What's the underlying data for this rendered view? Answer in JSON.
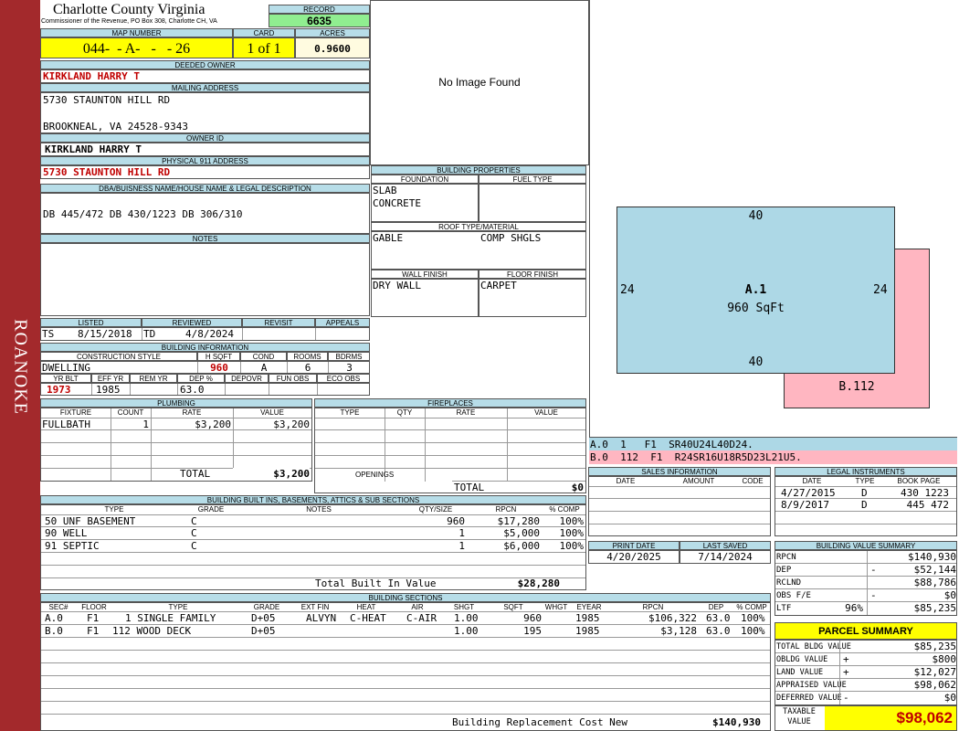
{
  "sidebar": {
    "label": "ROANOKE"
  },
  "header": {
    "county": "Charlotte County Virginia",
    "subtitle": "Commissioner of the Revenue, PO Box 308, Charlotte CH, VA",
    "record_label": "RECORD",
    "record_value": "6635",
    "map_number_label": "MAP NUMBER",
    "map_number_value": "044-  - A-   -   - 26",
    "card_label": "CARD",
    "card_value": "1 of 1",
    "acres_label": "ACRES",
    "acres_value": "0.9600"
  },
  "owner": {
    "deeded_owner_label": "DEEDED OWNER",
    "deeded_owner": "KIRKLAND HARRY T",
    "mailing_label": "MAILING ADDRESS",
    "mailing_line1": "5730 STAUNTON HILL RD",
    "mailing_line2": "BROOKNEAL, VA 24528-9343",
    "owner_id_label": "OWNER ID",
    "owner_id": "KIRKLAND HARRY T",
    "physical_label": "PHYSICAL 911 ADDRESS",
    "physical_address": "5730 STAUNTON HILL RD",
    "legal_label": "DBA/BUISNESS NAME/HOUSE NAME & LEGAL DESCRIPTION",
    "legal_description": "DB 445/472 DB 430/1223 DB 306/310",
    "notes_label": "NOTES"
  },
  "image": {
    "placeholder": "No Image Found"
  },
  "status": {
    "listed_label": "LISTED",
    "listed_by": "TS",
    "listed_date": "8/15/2018",
    "reviewed_label": "REVIEWED",
    "reviewed_by": "TD",
    "reviewed_date": "4/8/2024",
    "revisit_label": "REVISIT",
    "appeals_label": "APPEALS"
  },
  "building_info": {
    "title": "BUILDING INFORMATION",
    "construction_label": "CONSTRUCTION STYLE",
    "construction": "DWELLING",
    "hsqft_label": "H SQFT",
    "hsqft": "960",
    "cond_label": "COND",
    "cond": "A",
    "rooms_label": "ROOMS",
    "rooms": "6",
    "bdrms_label": "BDRMS",
    "bdrms": "3",
    "yrblt_label": "YR BLT",
    "yrblt": "1973",
    "effyr_label": "EFF YR",
    "effyr": "1985",
    "remyr_label": "REM YR",
    "remyr": "",
    "dep_label": "DEP %",
    "dep": "63.0",
    "depovr_label": "DEPOVR",
    "funobs_label": "FUN OBS",
    "ecoobs_label": "ECO OBS"
  },
  "building_props": {
    "title": "BUILDING PROPERTIES",
    "foundation_label": "FOUNDATION",
    "foundation": [
      "SLAB",
      "CONCRETE"
    ],
    "fuel_label": "FUEL TYPE",
    "roof_label": "ROOF TYPE/MATERIAL",
    "roof_type": "GABLE",
    "roof_material": "COMP SHGLS",
    "wall_label": "WALL FINISH",
    "wall": "DRY WALL",
    "floor_label": "FLOOR FINISH",
    "floor": "CARPET"
  },
  "sketch": {
    "a_top": "40",
    "a_bottom": "40",
    "a_left": "24",
    "a_right": "24",
    "a_name": "A.1",
    "a_area": "960 SqFt",
    "b_name": "B.112",
    "a_color": "#add8e6",
    "b_color": "#ffb6c1",
    "legend_a": "A.0  1   F1  SR40U24L40D24.",
    "legend_b": "B.0  112  F1  R24SR16U18R5D23L21U5."
  },
  "plumbing": {
    "title": "PLUMBING",
    "headers": [
      "FIXTURE",
      "COUNT",
      "RATE",
      "VALUE"
    ],
    "rows": [
      {
        "fixture": "FULLBATH",
        "count": "1",
        "rate": "$3,200",
        "value": "$3,200"
      }
    ],
    "total_label": "TOTAL",
    "total": "$3,200"
  },
  "fireplaces": {
    "title": "FIREPLACES",
    "headers": [
      "TYPE",
      "QTY",
      "RATE",
      "VALUE"
    ],
    "openings_label": "OPENINGS",
    "total_label": "TOTAL",
    "total": "$0"
  },
  "sales": {
    "title": "SALES INFORMATION",
    "headers": [
      "DATE",
      "AMOUNT",
      "CODE"
    ]
  },
  "legal": {
    "title": "LEGAL INSTRUMENTS",
    "headers": [
      "DATE",
      "TYPE",
      "BOOK PAGE"
    ],
    "rows": [
      {
        "date": "4/27/2015",
        "type": "D",
        "book": "430 1223"
      },
      {
        "date": "8/9/2017",
        "type": "D",
        "book": "445 472"
      }
    ]
  },
  "builtins": {
    "title": "BUILDING BUILT INS, BASEMENTS, ATTICS & SUB SECTIONS",
    "headers": [
      "TYPE",
      "GRADE",
      "NOTES",
      "QTY/SIZE",
      "RPCN",
      "% COMP"
    ],
    "rows": [
      {
        "type": "50 UNF BASEMENT",
        "grade": "C",
        "notes": "",
        "qty": "960",
        "rpcn": "$17,280",
        "comp": "100%"
      },
      {
        "type": "90 WELL",
        "grade": "C",
        "notes": "",
        "qty": "1",
        "rpcn": "$5,000",
        "comp": "100%"
      },
      {
        "type": "91 SEPTIC",
        "grade": "C",
        "notes": "",
        "qty": "1",
        "rpcn": "$6,000",
        "comp": "100%"
      }
    ],
    "total_label": "Total Built In Value",
    "total": "$28,280"
  },
  "print": {
    "print_label": "PRINT DATE",
    "print_date": "4/20/2025",
    "saved_label": "LAST SAVED",
    "saved_date": "7/14/2024"
  },
  "value_summary": {
    "title": "BUILDING VALUE SUMMARY",
    "rows": [
      {
        "label": "RPCN",
        "sign": "",
        "value": "$140,930"
      },
      {
        "label": "DEP",
        "sign": "-",
        "value": "$52,144"
      },
      {
        "label": "RCLND",
        "sign": "",
        "value": "$88,786"
      },
      {
        "label": "OBS F/E",
        "sign": "-",
        "value": "$0"
      },
      {
        "label": "LTF",
        "sign": "96%",
        "value": "$85,235"
      }
    ]
  },
  "sections": {
    "title": "BUILDING SECTIONS",
    "headers": [
      "SEC#",
      "FLOOR",
      "TYPE",
      "GRADE",
      "EXT FIN",
      "HEAT",
      "AIR",
      "SHGT",
      "SQFT",
      "WHGT",
      "EYEAR",
      "RPCN",
      "DEP",
      "% COMP"
    ],
    "rows": [
      {
        "sec": "A.0",
        "floor": "F1",
        "type": "1 SINGLE FAMILY",
        "grade": "D+05",
        "ext": "ALVYN",
        "heat": "C-HEAT",
        "air": "C-AIR",
        "shgt": "1.00",
        "sqft": "960",
        "whgt": "",
        "eyear": "1985",
        "rpcn": "$106,322",
        "dep": "63.0",
        "comp": "100%"
      },
      {
        "sec": "B.0",
        "floor": "F1",
        "type": "112 WOOD DECK",
        "grade": "D+05",
        "ext": "",
        "heat": "",
        "air": "",
        "shgt": "1.00",
        "sqft": "195",
        "whgt": "",
        "eyear": "1985",
        "rpcn": "$3,128",
        "dep": "63.0",
        "comp": "100%"
      }
    ],
    "replacement_label": "Building Replacement Cost New",
    "replacement": "$140,930"
  },
  "parcel": {
    "title": "PARCEL SUMMARY",
    "rows": [
      {
        "label": "TOTAL BLDG VALUE",
        "sign": "",
        "value": "$85,235"
      },
      {
        "label": "OBLDG VALUE",
        "sign": "+",
        "value": "$800"
      },
      {
        "label": "LAND VALUE",
        "sign": "+",
        "value": "$12,027"
      },
      {
        "label": "APPRAISED VALUE",
        "sign": "",
        "value": "$98,062"
      },
      {
        "label": "DEFERRED VALUE",
        "sign": "-",
        "value": "$0"
      }
    ],
    "taxable_label_1": "TAXABLE",
    "taxable_label_2": "VALUE",
    "taxable_value": "$98,062"
  }
}
